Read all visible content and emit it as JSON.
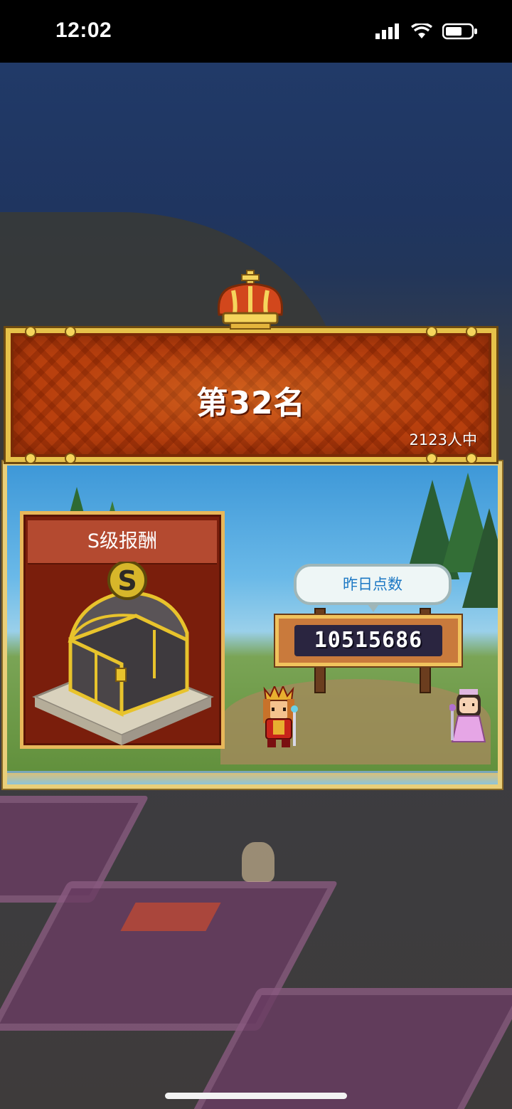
{
  "status_bar": {
    "time": "12:02",
    "icons": [
      "signal-icon",
      "wifi-icon",
      "battery-icon"
    ]
  },
  "ranking": {
    "rank_label": "第32名",
    "participants_label": "2123人中"
  },
  "reward": {
    "title": "S级报酬",
    "grade_letter": "S"
  },
  "score": {
    "bubble_label": "昨日点数",
    "value": "10515686"
  },
  "colors": {
    "banner_red": "#b9400e",
    "gold_border": "#e6c24a",
    "reward_card": "#7a1e0c",
    "bubble_text": "#1c78c4"
  }
}
